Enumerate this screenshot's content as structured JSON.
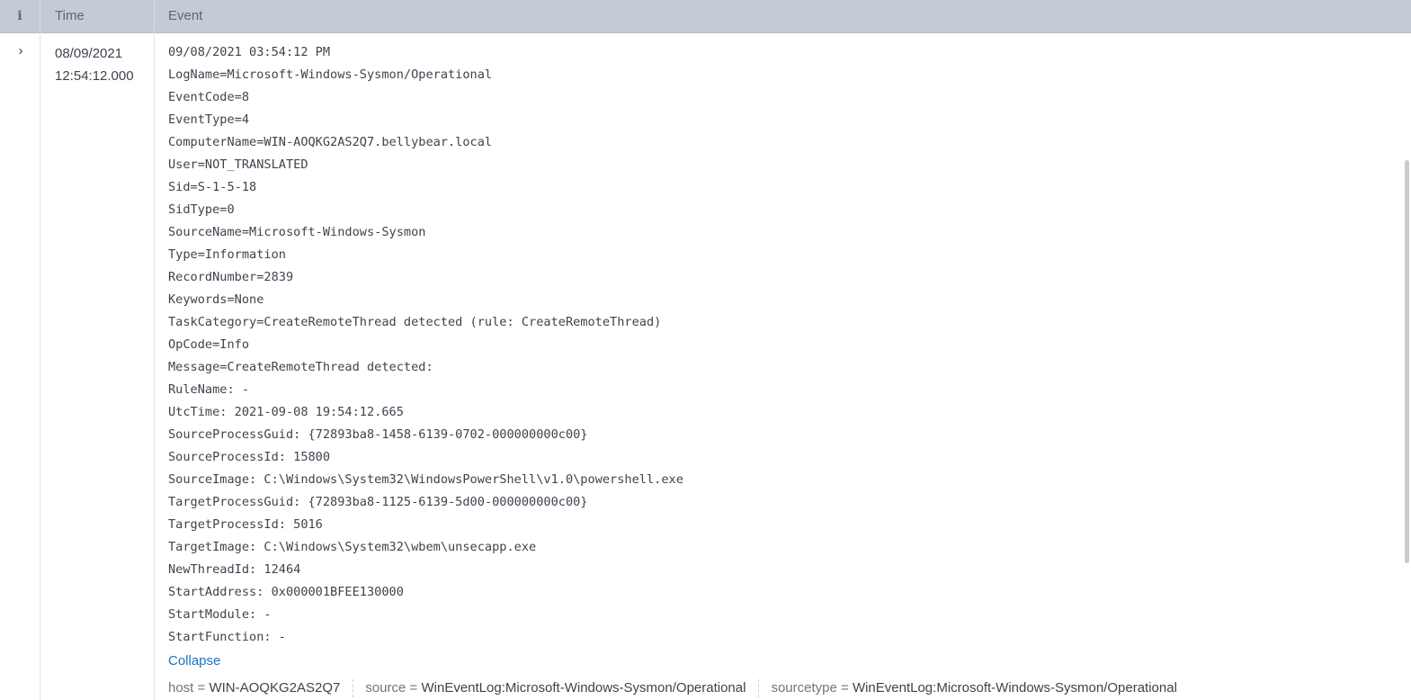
{
  "header": {
    "info_label": "i",
    "time_label": "Time",
    "event_label": "Event"
  },
  "row": {
    "expand_glyph": "›",
    "time_date": "08/09/2021",
    "time_clock": "12:54:12.000",
    "event_lines": [
      "09/08/2021 03:54:12 PM",
      "LogName=Microsoft-Windows-Sysmon/Operational",
      "EventCode=8",
      "EventType=4",
      "ComputerName=WIN-AOQKG2AS2Q7.bellybear.local",
      "User=NOT_TRANSLATED",
      "Sid=S-1-5-18",
      "SidType=0",
      "SourceName=Microsoft-Windows-Sysmon",
      "Type=Information",
      "RecordNumber=2839",
      "Keywords=None",
      "TaskCategory=CreateRemoteThread detected (rule: CreateRemoteThread)",
      "OpCode=Info",
      "Message=CreateRemoteThread detected:",
      "RuleName: -",
      "UtcTime: 2021-09-08 19:54:12.665",
      "SourceProcessGuid: {72893ba8-1458-6139-0702-000000000c00}",
      "SourceProcessId: 15800",
      "SourceImage: C:\\Windows\\System32\\WindowsPowerShell\\v1.0\\powershell.exe",
      "TargetProcessGuid: {72893ba8-1125-6139-5d00-000000000c00}",
      "TargetProcessId: 5016",
      "TargetImage: C:\\Windows\\System32\\wbem\\unsecapp.exe",
      "NewThreadId: 12464",
      "StartAddress: 0x000001BFEE130000",
      "StartModule: -",
      "StartFunction: -"
    ],
    "collapse_label": "Collapse",
    "fields": [
      {
        "key": "host",
        "value": "WIN-AOQKG2AS2Q7"
      },
      {
        "key": "source",
        "value": "WinEventLog:Microsoft-Windows-Sysmon/Operational"
      },
      {
        "key": "sourcetype",
        "value": "WinEventLog:Microsoft-Windows-Sysmon/Operational"
      }
    ]
  },
  "colors": {
    "header_bg": "#c3cbd4",
    "link": "#1a73c5",
    "text": "#3c444d"
  }
}
